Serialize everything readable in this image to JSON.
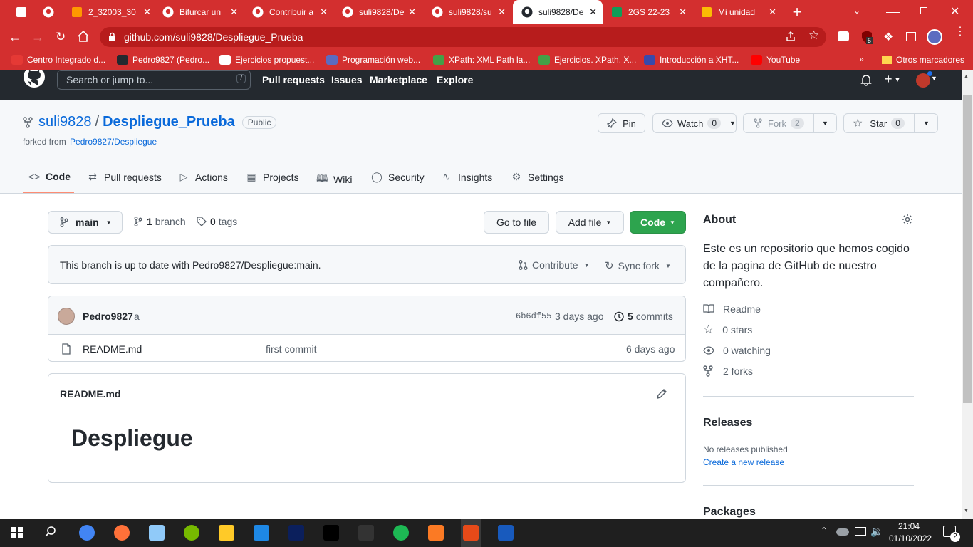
{
  "browser": {
    "tabs": [
      {
        "title": "",
        "icon": "calendar-icon"
      },
      {
        "title": "",
        "icon": "github-icon"
      },
      {
        "title": "2_32003_30",
        "icon": "moodle-icon"
      },
      {
        "title": "Bifurcar un",
        "icon": "github-icon"
      },
      {
        "title": "Contribuir a",
        "icon": "github-icon"
      },
      {
        "title": "suli9828/De",
        "icon": "github-icon"
      },
      {
        "title": "suli9828/su",
        "icon": "github-icon"
      },
      {
        "title": "suli9828/De",
        "icon": "github-icon",
        "active": true
      },
      {
        "title": "2GS 22-23",
        "icon": "classroom-icon"
      },
      {
        "title": "Mi unidad",
        "icon": "drive-icon"
      }
    ],
    "url": "github.com/suli9828/Despliegue_Prueba",
    "bookmarks": [
      "Centro Integrado d...",
      "Pedro9827 (Pedro...",
      "Ejercicios propuest...",
      "Programación web...",
      "XPath: XML Path la...",
      "Ejercicios. XPath. X...",
      "Introducción a XHT...",
      "YouTube"
    ],
    "other_bookmarks": "Otros marcadores",
    "extension_badge": "5",
    "accent": "#d32f2f"
  },
  "github": {
    "search_placeholder": "Search or jump to...",
    "search_key": "/",
    "nav": [
      "Pull requests",
      "Issues",
      "Marketplace",
      "Explore"
    ],
    "owner": "suli9828",
    "separator": "/",
    "repo": "Despliegue_Prueba",
    "visibility": "Public",
    "forked_prefix": "forked from",
    "forked_from": "Pedro9827/Despliegue",
    "pin": "Pin",
    "watch": "Watch",
    "watch_count": "0",
    "fork": "Fork",
    "fork_count": "2",
    "star": "Star",
    "star_count": "0",
    "tabs": [
      "Code",
      "Pull requests",
      "Actions",
      "Projects",
      "Wiki",
      "Security",
      "Insights",
      "Settings"
    ],
    "branch": "main",
    "branches_count": "1",
    "branches_label": "branch",
    "tags_count": "0",
    "tags_label": "tags",
    "go_to_file": "Go to file",
    "add_file": "Add file",
    "code_button": "Code",
    "branch_status": "This branch is up to date with Pedro9827/Despliegue:main.",
    "contribute": "Contribute",
    "sync_fork": "Sync fork",
    "commit_author": "Pedro9827",
    "commit_msg": "a",
    "commit_hash": "6b6df55",
    "commit_time": "3 days ago",
    "commits_count": "5",
    "commits_label": "commits",
    "files": [
      {
        "name": "README.md",
        "message": "first commit",
        "time": "6 days ago"
      }
    ],
    "readme_title": "README.md",
    "readme_heading": "Despliegue",
    "about_title": "About",
    "about_desc": "Este es un repositorio que hemos cogido de la pagina de GitHub de nuestro compañero.",
    "about_links": [
      "Readme",
      "0 stars",
      "0 watching",
      "2 forks"
    ],
    "releases_title": "Releases",
    "releases_none": "No releases published",
    "releases_create": "Create a new release",
    "packages_title": "Packages",
    "green": "#2da44e"
  },
  "taskbar": {
    "time": "21:04",
    "date": "01/10/2022",
    "notifications": "2"
  }
}
